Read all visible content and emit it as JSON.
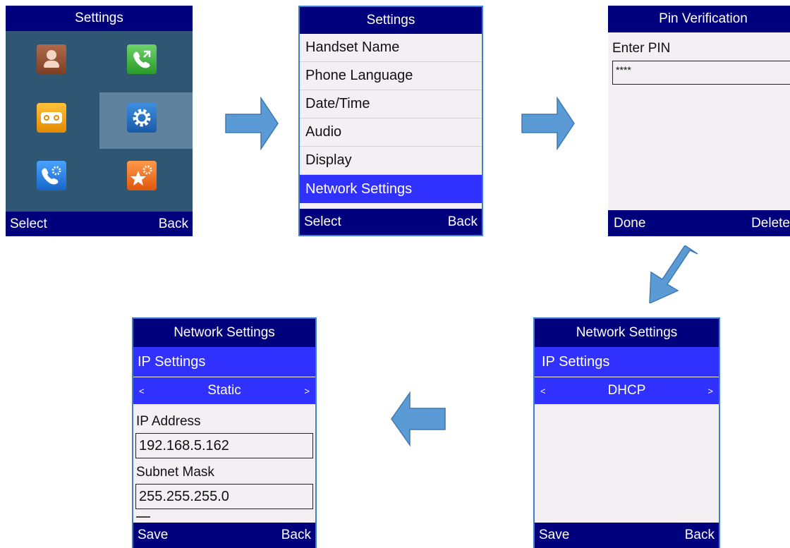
{
  "screen1": {
    "title": "Settings",
    "left_soft": "Select",
    "right_soft": "Back",
    "icons": [
      "contacts-icon",
      "call-history-icon",
      "voicemail-icon",
      "settings-gear-icon",
      "call-settings-icon",
      "advanced-settings-icon"
    ]
  },
  "screen2": {
    "title": "Settings",
    "items": [
      "Handset Name",
      "Phone Language",
      "Date/Time",
      "Audio",
      "Display",
      "Network Settings"
    ],
    "selected_index": 5,
    "left_soft": "Select",
    "right_soft": "Back"
  },
  "screen3": {
    "title": "Pin Verification",
    "prompt": "Enter PIN",
    "pin_value": "****",
    "left_soft": "Done",
    "right_soft": "Delete"
  },
  "screen4": {
    "title": "Network Settings",
    "section": "IP Settings",
    "mode_left": "<",
    "mode_value": "DHCP",
    "mode_right": ">",
    "left_soft": "Save",
    "right_soft": "Back"
  },
  "screen5": {
    "title": "Network Settings",
    "section": "IP Settings",
    "mode_left": "<",
    "mode_value": "Static",
    "mode_right": ">",
    "ip_label": "IP Address",
    "ip_value": "192.168.5.162",
    "mask_label": "Subnet Mask",
    "mask_value": "255.255.255.0",
    "left_soft": "Save",
    "right_soft": "Back"
  },
  "colors": {
    "header_bar": "#00007d",
    "highlight": "#3131ff",
    "screen_bg": "#f3eff3",
    "arrow": "#5b9bd5"
  }
}
